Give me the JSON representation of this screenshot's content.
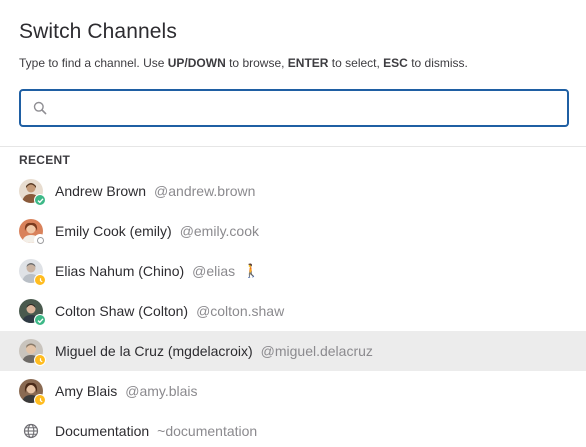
{
  "modal": {
    "title": "Switch Channels",
    "instructions": {
      "p1": "Type to find a channel. Use ",
      "k1": "UP/DOWN",
      "p2": " to browse, ",
      "k2": "ENTER",
      "p3": " to select, ",
      "k3": "ESC",
      "p4": " to dismiss."
    },
    "search": {
      "value": "",
      "placeholder": ""
    }
  },
  "recent": {
    "label": "RECENT",
    "items": [
      {
        "name": "Andrew Brown",
        "handle": "@andrew.brown",
        "status": "online",
        "emoji": ""
      },
      {
        "name": "Emily Cook (emily)",
        "handle": "@emily.cook",
        "status": "offline",
        "emoji": ""
      },
      {
        "name": "Elias Nahum (Chino)",
        "handle": "@elias",
        "status": "away",
        "emoji": "🚶"
      },
      {
        "name": "Colton Shaw (Colton)",
        "handle": "@colton.shaw",
        "status": "online",
        "emoji": ""
      },
      {
        "name": "Miguel de la Cruz (mgdelacroix)",
        "handle": "@miguel.delacruz",
        "status": "away",
        "emoji": "",
        "selected": true
      },
      {
        "name": "Amy Blais",
        "handle": "@amy.blais",
        "status": "away",
        "emoji": ""
      },
      {
        "name": "Documentation",
        "handle": "~documentation",
        "icon": "globe-icon"
      }
    ]
  },
  "colors": {
    "accent": "#1f5fa3",
    "online": "#3db887",
    "away": "#ffbc1f",
    "selected_row": "#ececec"
  }
}
